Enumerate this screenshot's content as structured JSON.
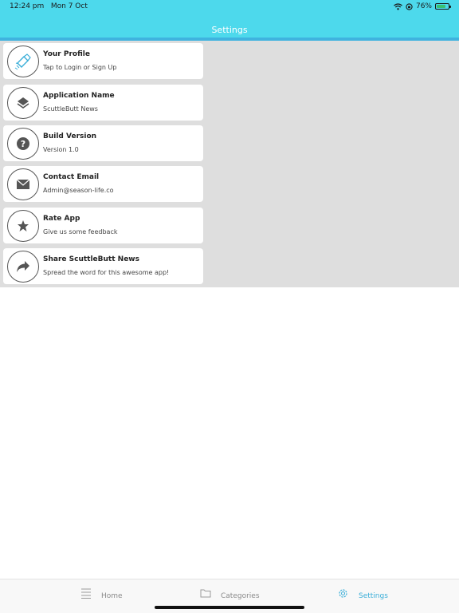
{
  "status_bar": {
    "time": "12:24 pm",
    "date": "Mon 7 Oct",
    "battery": "76%"
  },
  "nav": {
    "title": "Settings"
  },
  "items": [
    {
      "title": "Your Profile",
      "subtitle": "Tap to Login or Sign Up",
      "icon": "profile-logo-icon"
    },
    {
      "title": "Application Name",
      "subtitle": "ScuttleButt News",
      "icon": "layers-icon"
    },
    {
      "title": "Build Version",
      "subtitle": "Version 1.0",
      "icon": "question-icon"
    },
    {
      "title": "Contact Email",
      "subtitle": "Admin@season-life.co",
      "icon": "envelope-icon"
    },
    {
      "title": "Rate App",
      "subtitle": "Give us some feedback",
      "icon": "star-icon"
    },
    {
      "title": "Share ScuttleButt News",
      "subtitle": "Spread the word for this awesome app!",
      "icon": "share-arrow-icon"
    }
  ],
  "tabs": [
    {
      "label": "Home",
      "icon": "list-icon",
      "active": false
    },
    {
      "label": "Categories",
      "icon": "folder-icon",
      "active": false
    },
    {
      "label": "Settings",
      "icon": "gear-icon",
      "active": true
    }
  ],
  "colors": {
    "accent": "#4dd9ec",
    "accent_dark": "#3fb3df",
    "active_tab": "#3aaed8"
  }
}
